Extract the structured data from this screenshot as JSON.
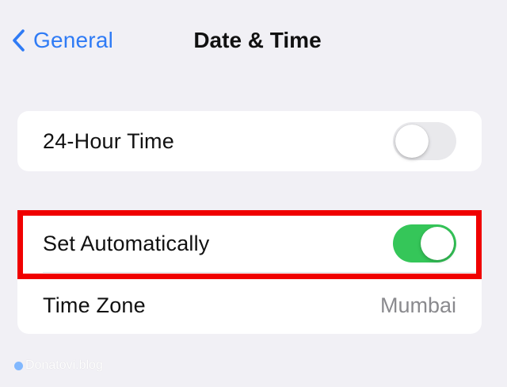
{
  "nav": {
    "back_label": "General",
    "title": "Date & Time"
  },
  "settings": {
    "hour24": {
      "label": "24-Hour Time",
      "enabled": false
    },
    "set_automatically": {
      "label": "Set Automatically",
      "enabled": true
    },
    "time_zone": {
      "label": "Time Zone",
      "value": "Mumbai"
    }
  },
  "watermark": {
    "text": "Donatovi.blog"
  },
  "colors": {
    "background": "#f1f0f5",
    "accent": "#2f7bf5",
    "toggle_on": "#35c659",
    "toggle_off": "#e9e9ec",
    "highlight": "#f00000"
  },
  "icons": {
    "back": "chevron-left-icon",
    "watermark": "blue-dot-icon"
  }
}
